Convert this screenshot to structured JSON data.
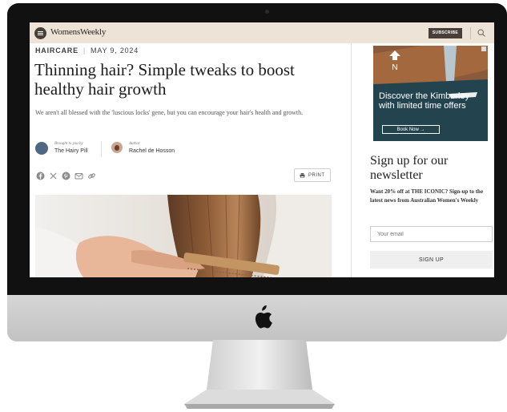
{
  "site": {
    "logo_text": "WomensWeekly"
  },
  "header": {
    "subscribe_label": "SUBSCRIBE",
    "search_icon": "search-icon",
    "menu_icon": "menu-icon"
  },
  "article": {
    "category": "HAIRCARE",
    "divider": "|",
    "date": "MAY 9, 2024",
    "title": "Thinning hair? Simple tweaks to boost healthy hair growth",
    "standfirst": "We aren't all blessed with the 'luscious locks' gene, but you can encourage your hair's health and growth.",
    "sponsor": {
      "prefix": "Brought to you by",
      "name": "The Hairy Pill"
    },
    "author": {
      "prefix": "Author",
      "name": "Rachel de Hosson"
    },
    "share_icons": [
      "facebook-icon",
      "x-icon",
      "pinterest-icon",
      "email-icon",
      "link-icon"
    ],
    "print_label": "PRINT"
  },
  "ad": {
    "headline": "Discover the Kimberley with limited time offers",
    "cta": "Book Now →"
  },
  "newsletter": {
    "title": "Sign up for our newsletter",
    "text": "Want 20% off at THE ICONIC? Sign-up to the latest news from Australian Women's Weekly",
    "email_placeholder": "Your email",
    "button": "SIGN UP"
  },
  "colors": {
    "header_bg": "#ede3d6",
    "brand_dark": "#4a3f38",
    "bezel": "#111111",
    "chin": "#c9c9c9"
  }
}
